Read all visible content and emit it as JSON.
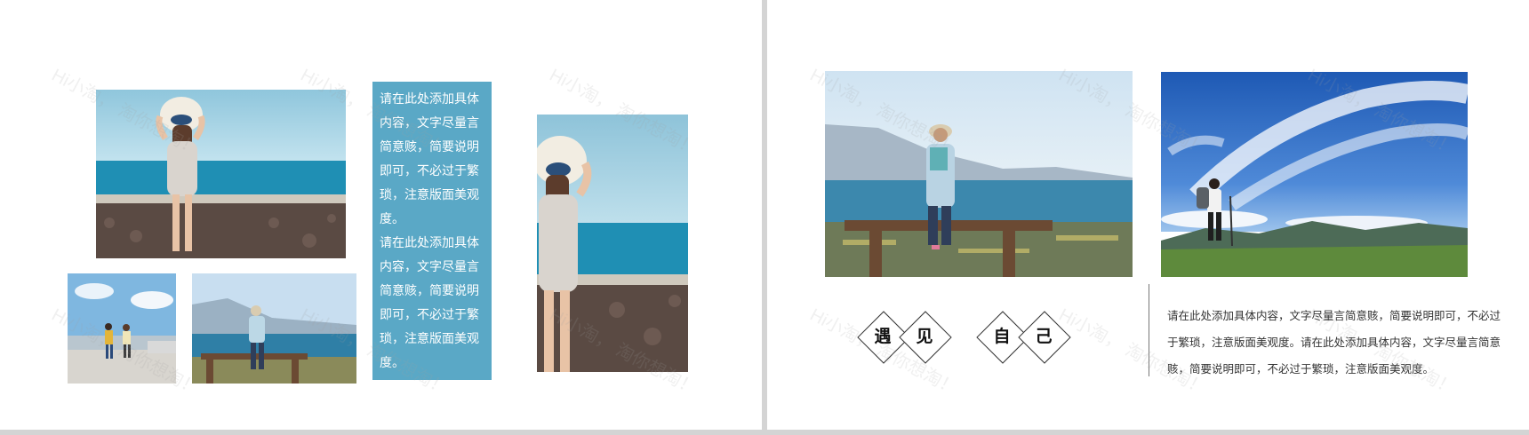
{
  "left_page": {
    "text_block": {
      "paragraphs": [
        "请在此处添加具体内容，文字尽量言简意赅，简要说明即可，不必过于繁琐，注意版面美观度。",
        "请在此处添加具体内容，文字尽量言简意赅，简要说明即可，不必过于繁琐，注意版面美观度。"
      ]
    }
  },
  "right_page": {
    "title_chars": [
      "遇",
      "见",
      "自",
      "己"
    ],
    "body_text": "请在此处添加具体内容，文字尽量言简意赅，简要说明即可，不必过于繁琐，注意版面美观度。请在此处添加具体内容，文字尽量言简意赅，简要说明即可，不必过于繁琐，注意版面美观度。"
  },
  "watermark": {
    "line1": "Hi小淘，",
    "line2": "淘你想淘！"
  },
  "colors": {
    "text_block_bg": "#5aa8c6",
    "page_bg": "#ffffff",
    "divider": "#d4d4d4"
  }
}
